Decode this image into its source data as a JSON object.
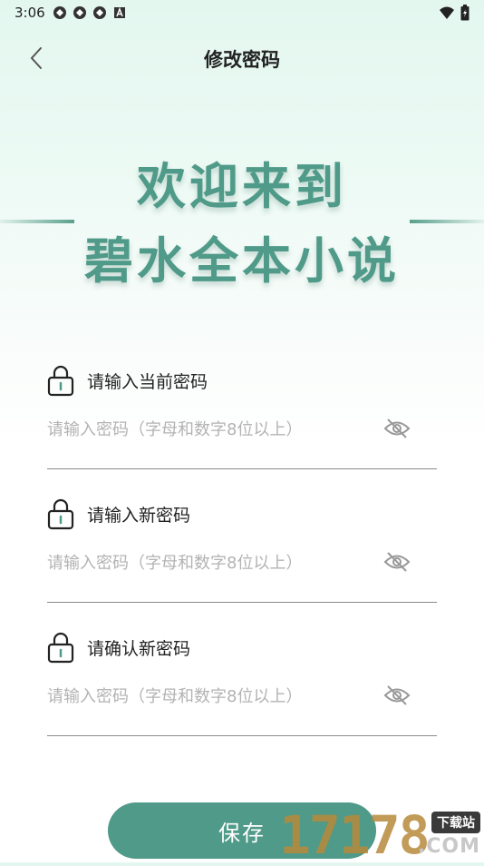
{
  "status_bar": {
    "time": "3:06"
  },
  "app_bar": {
    "title": "修改密码",
    "back_icon": "chevron-left-icon"
  },
  "welcome": {
    "line1": "欢迎来到",
    "line2": "碧水全本小说"
  },
  "fields": [
    {
      "label": "请输入当前密码",
      "placeholder": "请输入密码（字母和数字8位以上）",
      "value": ""
    },
    {
      "label": "请输入新密码",
      "placeholder": "请输入密码（字母和数字8位以上）",
      "value": ""
    },
    {
      "label": "请确认新密码",
      "placeholder": "请输入密码（字母和数字8位以上）",
      "value": ""
    }
  ],
  "save_button": {
    "label": "保存"
  },
  "watermark": {
    "digits": "17178",
    "badge": "下载站",
    "suffix": ".COM"
  },
  "colors": {
    "accent": "#4f9a88",
    "text": "#222222",
    "placeholder": "#b3b3b3",
    "underline": "#8a8a8a"
  }
}
